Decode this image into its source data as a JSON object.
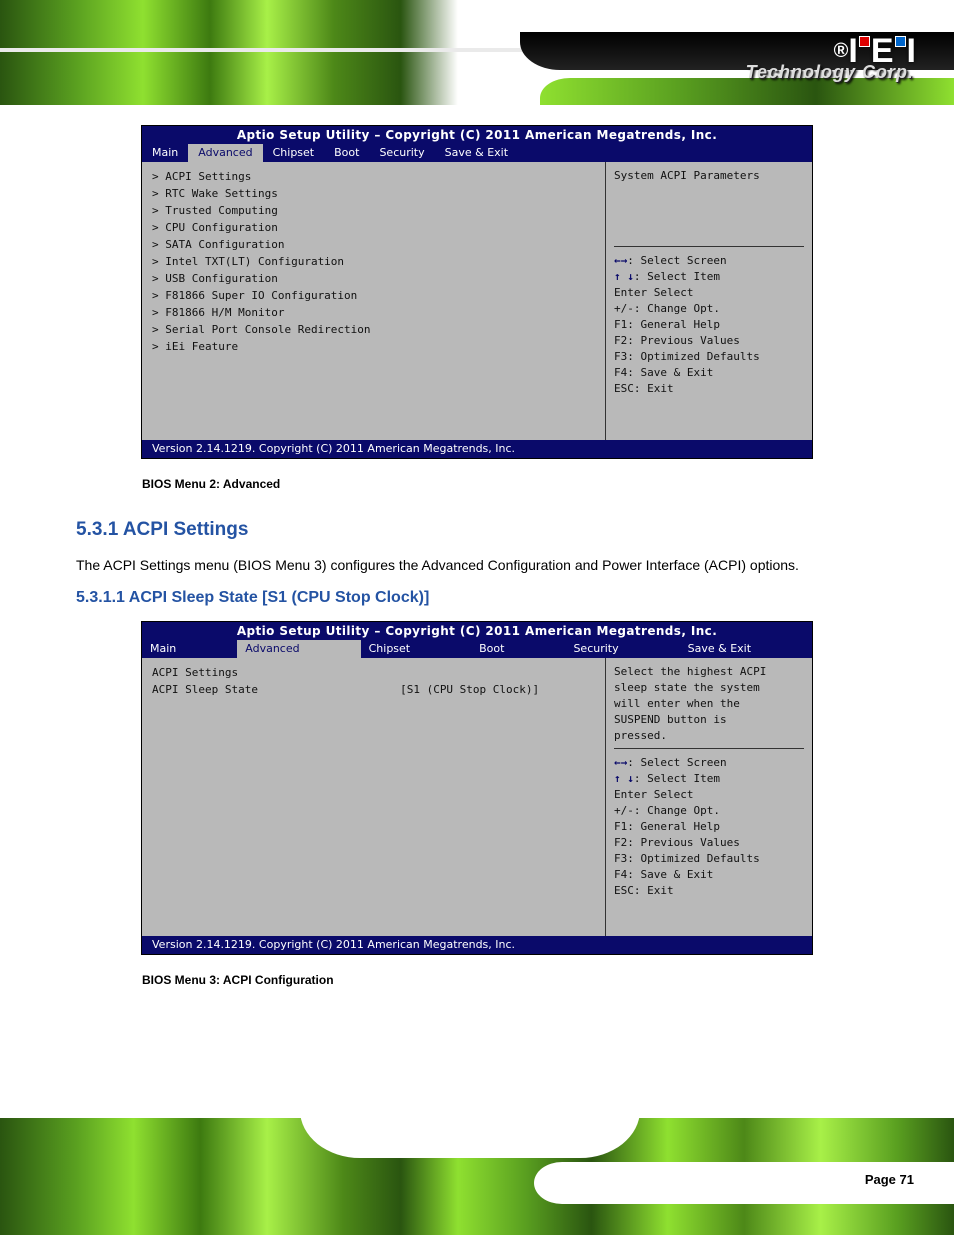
{
  "brand": {
    "reg": "®",
    "tech": "Technology Corp."
  },
  "bios1": {
    "title": "Aptio Setup Utility – Copyright (C) 2011 American Megatrends, Inc.",
    "tabs": [
      "Main",
      "Advanced",
      "Chipset",
      "Boot",
      "Security",
      "Save & Exit"
    ],
    "active_tab": "Advanced",
    "rows": [
      {
        "k": "> ACPI Settings",
        "v": ""
      },
      {
        "k": "> RTC Wake Settings",
        "v": ""
      },
      {
        "k": "> Trusted Computing",
        "v": ""
      },
      {
        "k": "> CPU Configuration",
        "v": ""
      },
      {
        "k": "> SATA Configuration",
        "v": ""
      },
      {
        "k": "> Intel TXT(LT) Configuration",
        "v": ""
      },
      {
        "k": "> USB Configuration",
        "v": ""
      },
      {
        "k": "> F81866 Super IO Configuration",
        "v": ""
      },
      {
        "k": "> F81866 H/M Monitor",
        "v": ""
      },
      {
        "k": "> Serial Port Console Redirection",
        "v": ""
      },
      {
        "k": "> iEi Feature",
        "v": ""
      }
    ],
    "hint_top": "System ACPI Parameters",
    "keys": [
      "←→: Select Screen",
      "↑ ↓: Select Item",
      "Enter Select",
      "+/-: Change Opt.",
      "F1: General Help",
      "F2: Previous Values",
      "F3: Optimized Defaults",
      "F4: Save & Exit",
      "ESC: Exit"
    ],
    "bar": "Version 2.14.1219. Copyright (C) 2011 American Megatrends, Inc.",
    "cap": "BIOS Menu 2: Advanced"
  },
  "section": {
    "h1": "5.3.1 ACPI Settings",
    "p": "The ACPI Settings menu (BIOS Menu 3) configures the Advanced Configuration and Power Interface (ACPI) options.",
    "h2": "5.3.1.1 ACPI Sleep State [S1 (CPU Stop Clock)]"
  },
  "bios2": {
    "title": "Aptio Setup Utility – Copyright (C) 2011 American Megatrends, Inc.",
    "tabs": [
      "Main",
      "Advanced",
      "Chipset",
      "Boot",
      "Security",
      "Save & Exit"
    ],
    "active_tab": "Advanced",
    "rows": [
      {
        "k": "ACPI Settings",
        "v": ""
      },
      {
        "k": "",
        "v": ""
      },
      {
        "k": "ACPI Sleep State",
        "v": "[S1 (CPU Stop Clock)]"
      }
    ],
    "hint_top1": "Select the highest ACPI",
    "hint_top2": "sleep state the system",
    "hint_top3": "will enter when the",
    "hint_top4": "SUSPEND button is",
    "hint_top5": "pressed.",
    "keys": [
      "←→: Select Screen",
      "↑ ↓: Select Item",
      "Enter Select",
      "+/-: Change Opt.",
      "F1: General Help",
      "F2: Previous Values",
      "F3: Optimized Defaults",
      "F4: Save & Exit",
      "ESC: Exit"
    ],
    "bar": "Version 2.14.1219. Copyright (C) 2011 American Megatrends, Inc.",
    "cap": "BIOS Menu 3: ACPI Configuration"
  },
  "footer": {
    "page": "Page 71"
  }
}
